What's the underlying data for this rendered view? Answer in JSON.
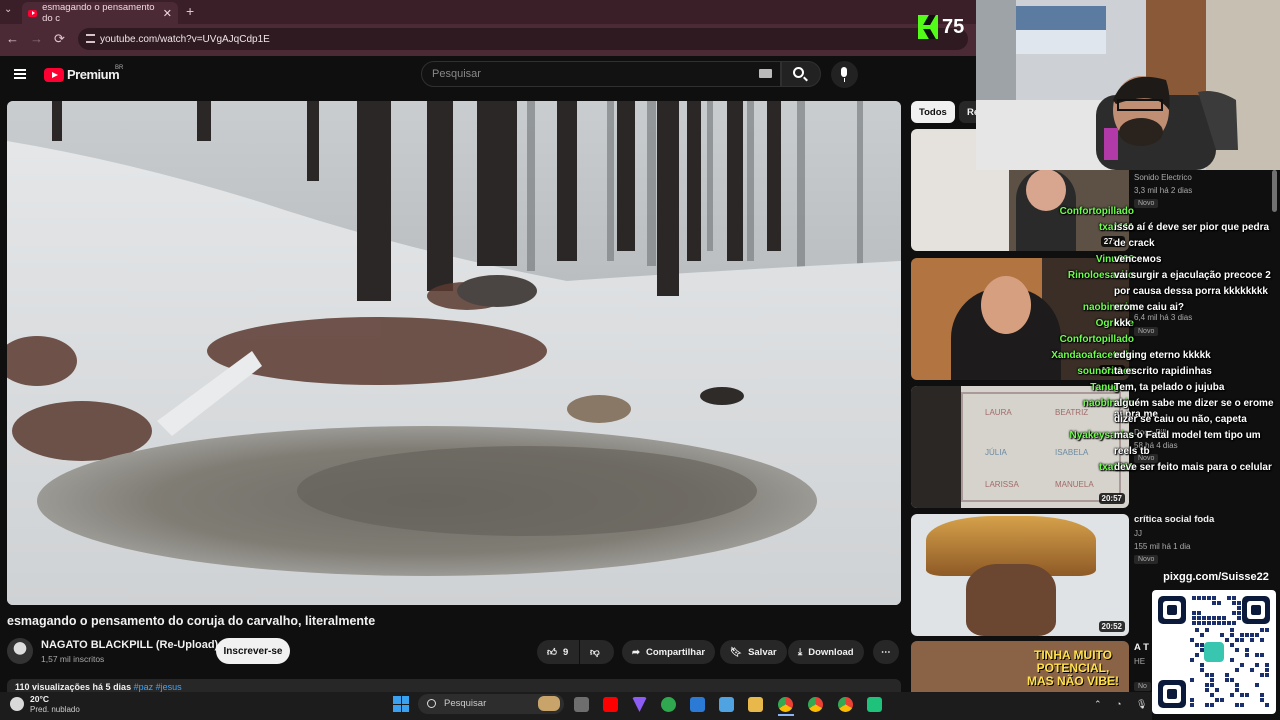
{
  "browser": {
    "tab_title": "esmagando o pensamento do c",
    "tab_close": "✕",
    "tab_new": "+",
    "url": "youtube.com/watch?v=UVgAJqCdp1E",
    "nav_back": "←",
    "nav_forward": "→",
    "nav_reload": "⟳"
  },
  "youtube": {
    "logo_text": "Premium",
    "logo_region": "BR",
    "search_placeholder": "Pesquisar"
  },
  "video": {
    "title": "esmagando o pensamento do coruja do carvalho, literalmente",
    "channel_name": "NAGATO BLACKPILL (Re-Upload)",
    "channel_subs": "1,57 mil inscritos",
    "subscribe_label": "Inscrever-se",
    "likes": "9",
    "share_label": "Compartilhar",
    "save_label": "Salvar",
    "download_label": "Download",
    "views_line": "110 visualizações há 5 dias",
    "tags": "#paz #jesus"
  },
  "sidebar": {
    "chips": [
      "Todos",
      "Re"
    ],
    "items": [
      {
        "title": "",
        "channel": "Sonido Electrico",
        "meta": "3,3 mil  há 2 dias",
        "badge": "Novo",
        "duration": "27:..."
      },
      {
        "title": "",
        "channel": "",
        "meta": "6,4 mil  há 3 dias",
        "badge": "Novo",
        "duration": "13:10"
      },
      {
        "title": "",
        "channel": "Dogo Pill",
        "meta": "58  há 4 dias",
        "badge": "Novo",
        "duration": "20:57"
      },
      {
        "title": "crítica social foda",
        "channel": "JJ",
        "meta": "155 mil  há 1 dia",
        "badge": "Novo",
        "duration": "20:52"
      },
      {
        "title": "A T",
        "channel": "HE",
        "meta": "",
        "badge": "No",
        "duration": ""
      }
    ],
    "thumb5_caption": [
      "TINHA MUITO",
      "POTENCIAL,",
      "MAS NÃO VIBE!"
    ],
    "thumb3_names": [
      "LAURA",
      "BEATRIZ",
      "JÚLIA",
      "ISABELA",
      "LARISSA",
      "MANUELA"
    ]
  },
  "chat": [
    {
      "user": "Confortopillado",
      "msg": ""
    },
    {
      "user": "txa1111",
      "msg": "isso aí é deve ser pior que pedra"
    },
    {
      "user": "",
      "msg": "de crack"
    },
    {
      "user": "Vinu666",
      "msg": "venceмos"
    },
    {
      "user": "Rinoloesaeiro",
      "msg": "vai surgir a ejaculação precoce 2"
    },
    {
      "user": "",
      "msg": "por causa dessa porra kkkkkkkk"
    },
    {
      "user": "naobinario",
      "msg": "erome caiu ai?"
    },
    {
      "user": "Ogroide",
      "msg": "kkk"
    },
    {
      "user": "Confortopillado",
      "msg": ""
    },
    {
      "user": "Xandaoafacetado",
      "msg": "edging eterno kkkkk"
    },
    {
      "user": "sounorimes",
      "msg": "ta escrito rapidinhas"
    },
    {
      "user": "Tanugam",
      "msg": "Tem, ta pelado o jujuba"
    },
    {
      "user": "naobinario",
      "msg": "alguém sabe me dizer se o erome ai pra me"
    },
    {
      "user": "",
      "msg": "dizer se caiu ou não, capeta"
    },
    {
      "user": "Nyakeysaeiro",
      "msg": "mas o Fatal model tem tipo um"
    },
    {
      "user": "",
      "msg": "reels tb"
    },
    {
      "user": "txa1111",
      "msg": "deve ser feito mais para o celular"
    }
  ],
  "stream": {
    "kick_viewers": "75",
    "qr_label": "pixgg.com/Suisse22"
  },
  "taskbar": {
    "temperature": "20°C",
    "weather": "Pred. nublado",
    "search_placeholder": "Pesquisar"
  },
  "colors": {
    "chat_user": "#6cff4b",
    "youtube_red": "#ff0033",
    "kick_green": "#53fc18",
    "browser_chrome": "#4b2a35"
  }
}
